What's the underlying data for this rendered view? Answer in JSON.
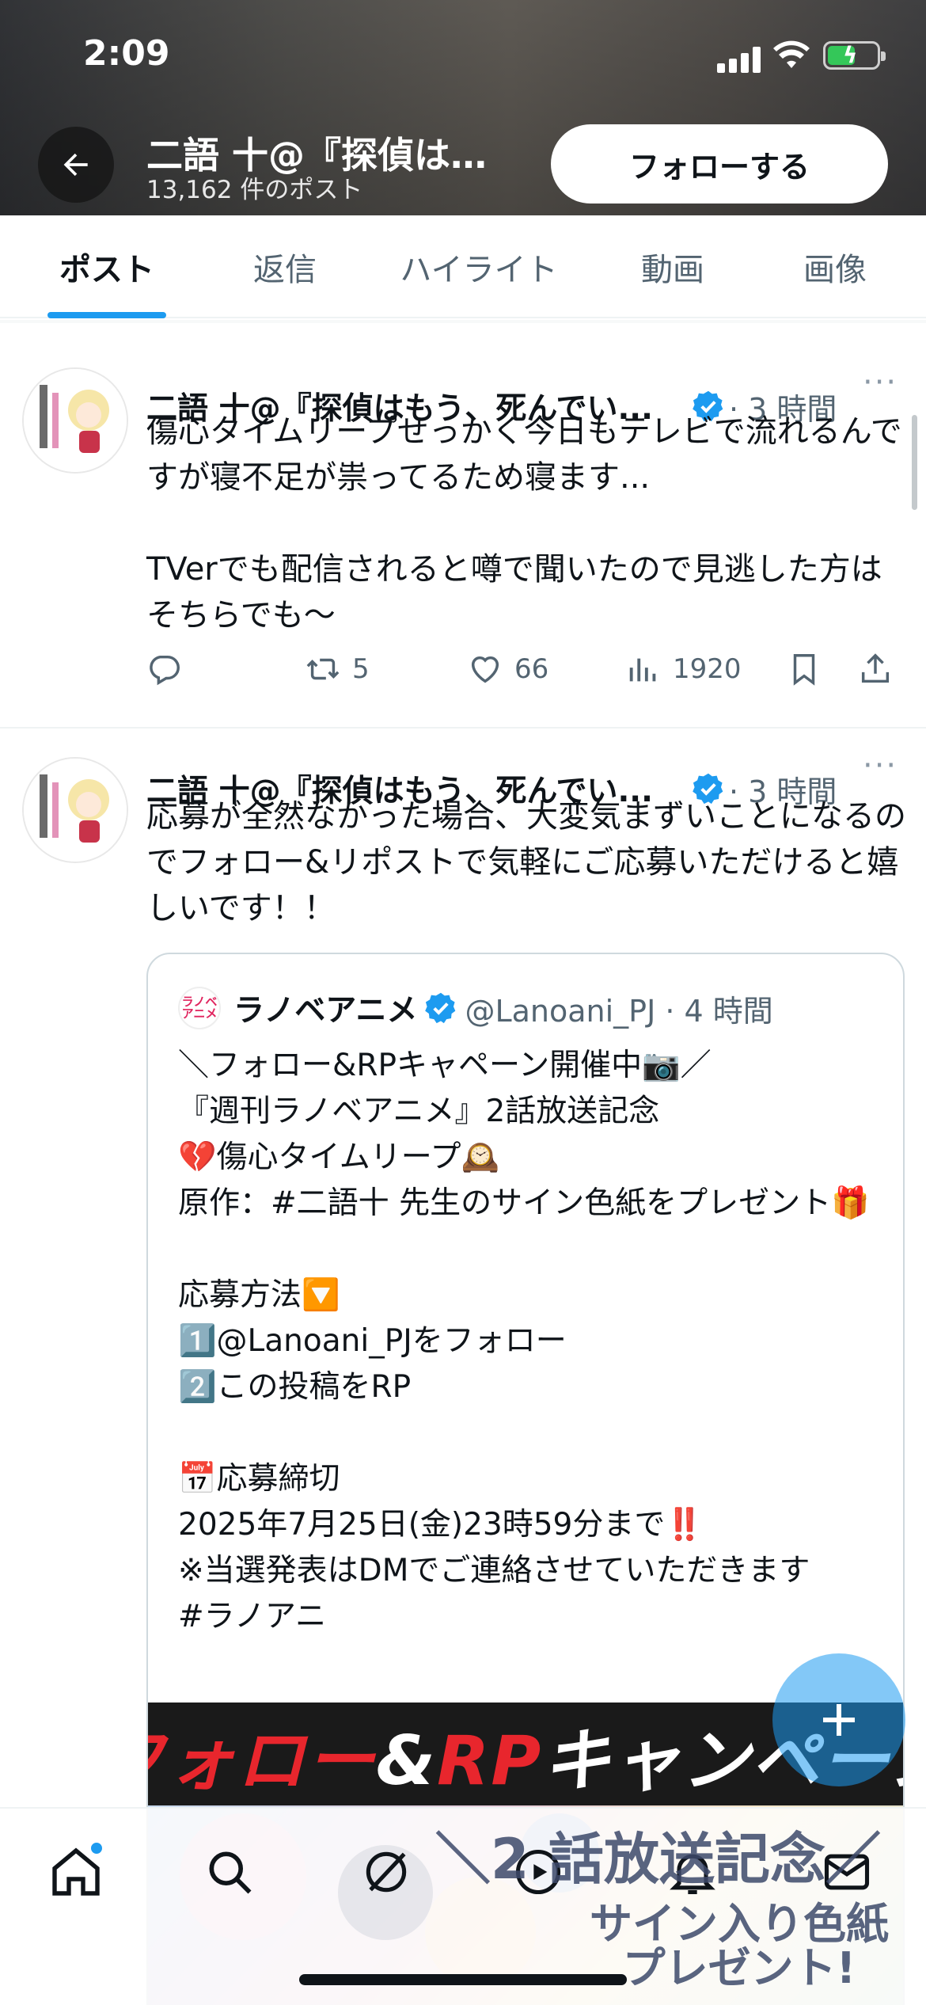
{
  "status_bar": {
    "time": "2:09"
  },
  "header": {
    "profile_name": "二語 十@『探偵は…",
    "post_count": "13,162 件のポスト",
    "follow_label": "フォローする"
  },
  "tabs": [
    {
      "label": "ポスト",
      "active": true
    },
    {
      "label": "返信"
    },
    {
      "label": "ハイライト"
    },
    {
      "label": "動画"
    },
    {
      "label": "画像"
    }
  ],
  "posts": [
    {
      "author": "二語 十@『探偵はもう、死んでい...",
      "time": "· 3 時間",
      "text": "傷心タイムリープせっかく今日もテレビで流れるんですが寝不足が祟ってるため寝ます...\n\nTVerでも配信されると噂で聞いたので見逃した方はそちらでも〜",
      "reposts": "5",
      "likes": "66",
      "views": "1920",
      "more": "···"
    },
    {
      "author": "二語 十@『探偵はもう、死んでい...",
      "time": "· 3 時間",
      "text": "応募が全然なかった場合、大変気まずいことになるのでフォロー&リポストで気軽にご応募いただけると嬉しいです！！",
      "more": "···",
      "quote": {
        "avatar_text": "ラノベ\nアニメ",
        "name": "ラノベアニメ",
        "handle": "@Lanoani_PJ · 4 時間",
        "text": "＼フォロー&RPキャペーン開催中📷／\n『週刊ラノベアニメ』2話放送記念\n💔傷心タイムリープ🕰️\n原作：#二語十 先生のサイン色紙をプレゼント🎁\n\n応募方法🔽\n1️⃣@Lanoani_PJをフォロー\n2️⃣この投稿をRP\n\n📅応募締切\n2025年7月25日(金)23時59分まで‼️\n※当選発表はDMでご連絡させていただきます\n#ラノアニ",
        "banner": {
          "part1": "フォロー",
          "part2": "&",
          "part3": "RP",
          "part4": "キャンペーン"
        },
        "art_caption1": "＼2 話放送記念／",
        "art_caption2": "サイン入り色紙\nプレゼント!"
      }
    }
  ],
  "colors": {
    "accent": "#1d9bf0",
    "text": "#0f1419",
    "muted": "#536471",
    "border": "#eff3f4"
  },
  "icons": [
    "back-arrow-icon",
    "verified-badge-icon",
    "reply-icon",
    "repost-icon",
    "like-icon",
    "views-icon",
    "bookmark-icon",
    "share-icon",
    "compose-plus-icon",
    "home-icon",
    "search-icon",
    "grok-icon",
    "video-icon",
    "notifications-icon",
    "messages-icon"
  ]
}
